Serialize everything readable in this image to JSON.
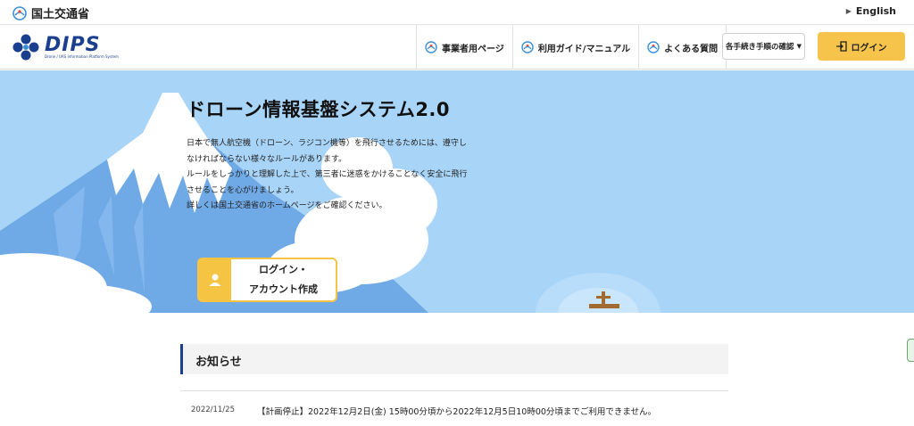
{
  "topbar": {
    "ministry": "国土交通省",
    "language": "English"
  },
  "header": {
    "logo_text": "DIPS",
    "logo_sub": "Drone / UAS Information Platform System",
    "nav": [
      {
        "label": "事業者用ページ"
      },
      {
        "label": "利用ガイド/マニュアル"
      },
      {
        "label": "よくある質問"
      }
    ],
    "procedure_label": "各手続き手順の確認",
    "login_label": "ログイン"
  },
  "hero": {
    "title": "ドローン情報基盤システム2.0",
    "description": [
      "日本で無人航空機（ドローン、ラジコン機等）を飛行させるためには、遵守し",
      "なければならない様々なルールがあります。",
      "ルールをしっかりと理解した上で、第三者に迷惑をかけることなく安全に飛行",
      "させることを心がけましょう。",
      "詳しくは国土交通省のホームページをご確認ください。"
    ],
    "cta_line1": "ログイン・",
    "cta_line2": "アカウント作成"
  },
  "news": {
    "heading": "お知らせ",
    "items": [
      {
        "date": "2022/11/25",
        "text": "【計画停止】2022年12月2日(金) 15時00分頃から2022年12月5日10時00分頃までご利用できません。"
      }
    ]
  },
  "colors": {
    "brand_blue": "#1b3f8f",
    "accent_yellow": "#f6c44a",
    "sky": "#a8d4f7"
  }
}
